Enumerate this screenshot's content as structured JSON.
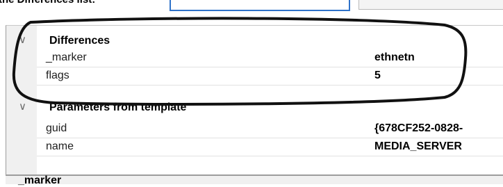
{
  "caption": "the Differences list:",
  "grid": {
    "categories": [
      {
        "label": "Differences",
        "rows": [
          {
            "key": "_marker",
            "value": "ethnetn"
          },
          {
            "key": "flags",
            "value": "5"
          }
        ]
      },
      {
        "label": "Parameters from template",
        "rows": [
          {
            "key": "guid",
            "value": "{678CF252-0828-"
          },
          {
            "key": "name",
            "value": "MEDIA_SERVER"
          }
        ]
      }
    ]
  },
  "description": {
    "title": "_marker"
  },
  "colors": {
    "annotation_oval": "#111111",
    "focus_border": "#2f72c9",
    "gutter": "#f0f0f0"
  },
  "icons": {
    "category_toggle": "chevron-down-icon"
  }
}
